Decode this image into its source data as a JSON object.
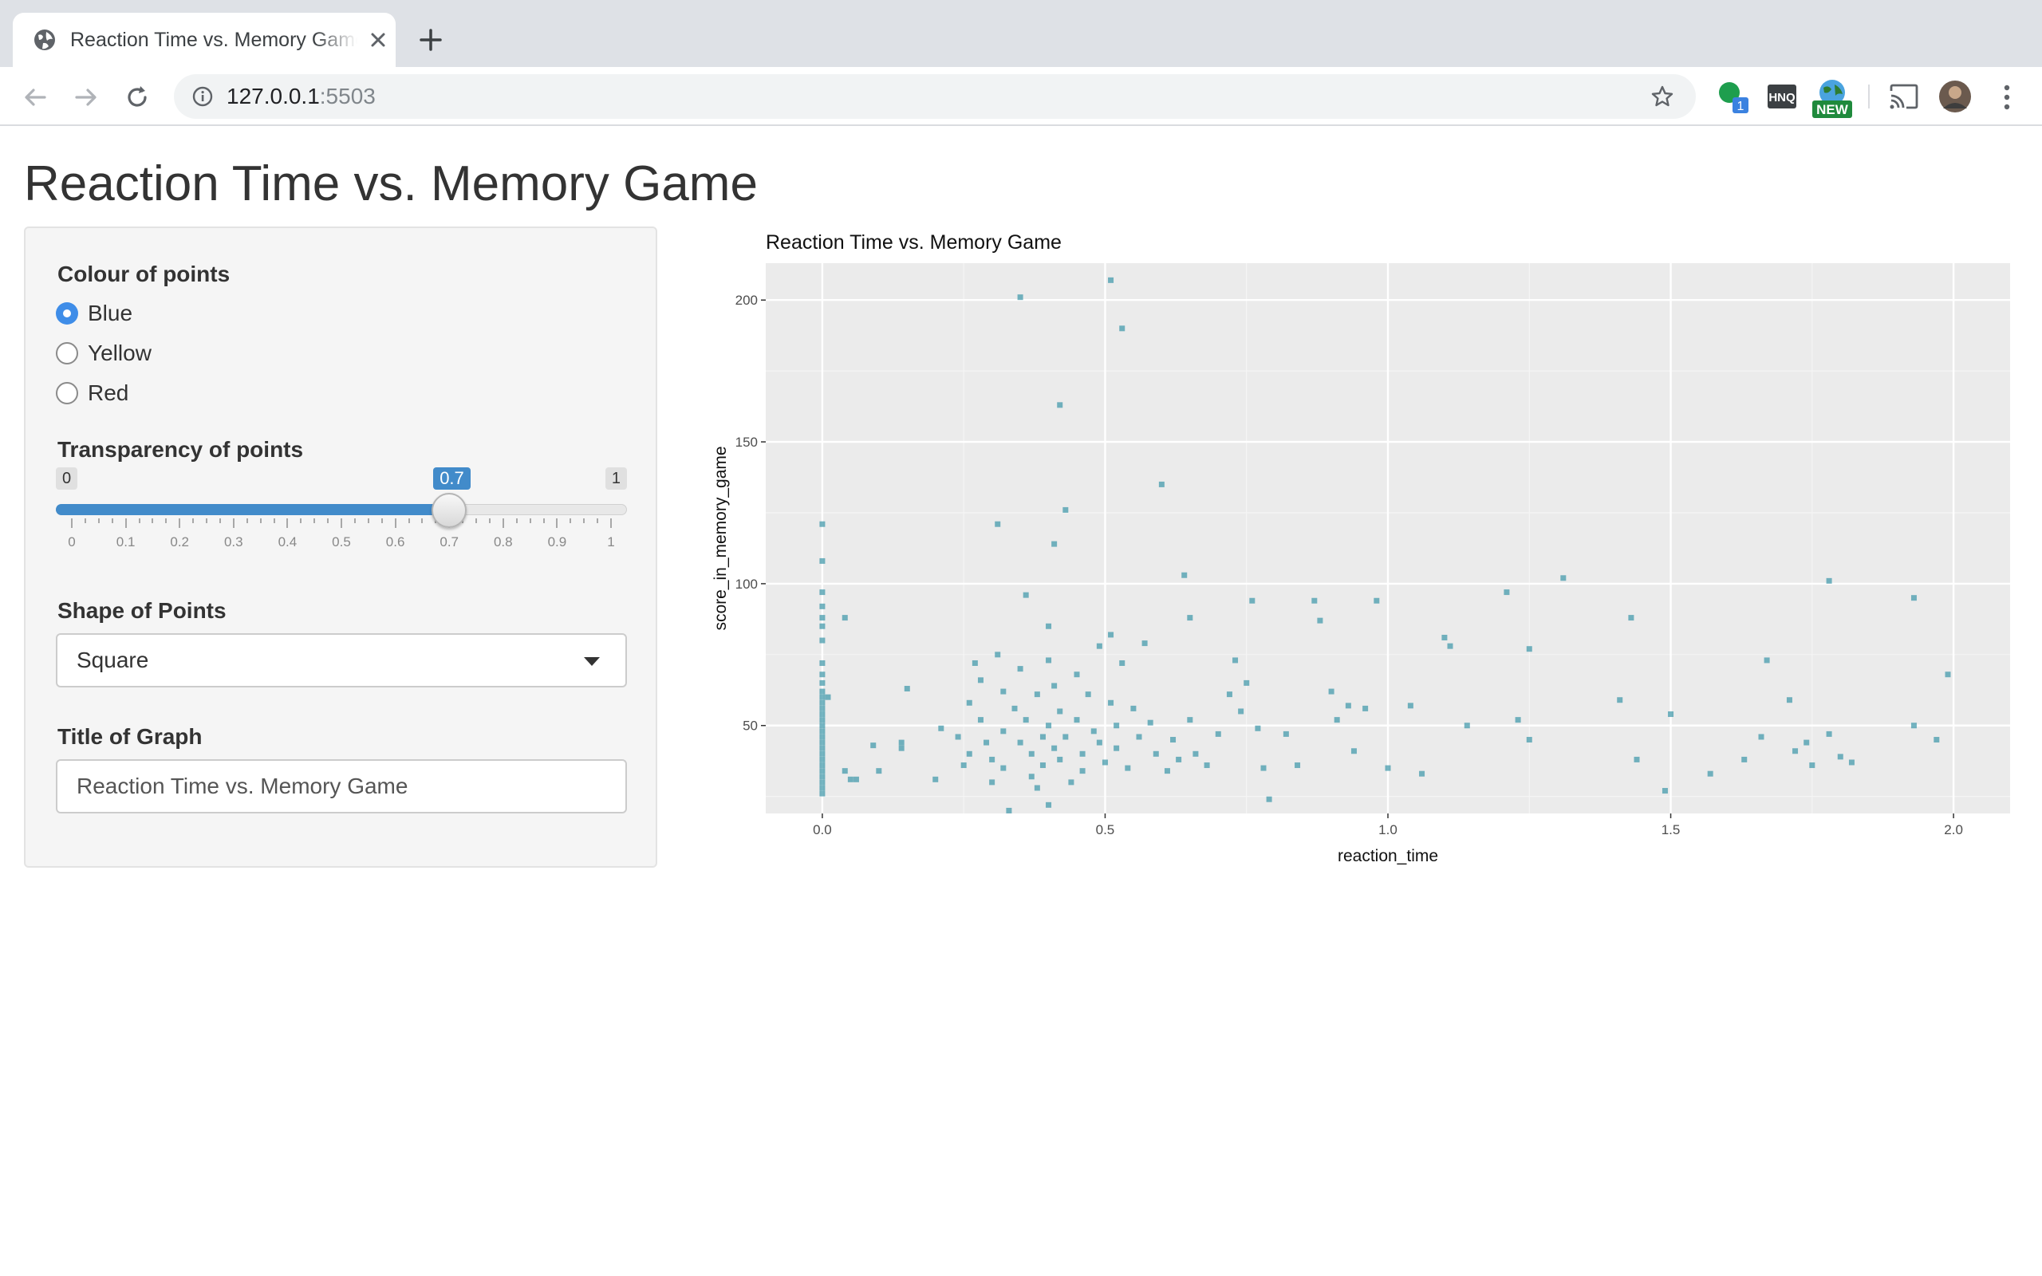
{
  "browser": {
    "tab_title": "Reaction Time vs. Memory Game",
    "url_host": "127.0.0.1",
    "url_port": ":5503",
    "extensions": [
      {
        "icon": "green-dot-extension-icon",
        "badge": "1"
      },
      {
        "icon": "hnq-extension-icon",
        "label": "HNQ"
      },
      {
        "icon": "globe-extension-icon",
        "badge": "NEW"
      },
      {
        "icon": "cast-icon"
      },
      {
        "icon": "profile-avatar"
      },
      {
        "icon": "more-menu-icon"
      }
    ]
  },
  "app": {
    "title": "Reaction Time vs. Memory Game"
  },
  "sidebar": {
    "colour": {
      "label": "Colour of points",
      "options": [
        "Blue",
        "Yellow",
        "Red"
      ],
      "selected": "Blue"
    },
    "transparency": {
      "label": "Transparency of points",
      "min": "0",
      "max": "1",
      "value": 0.7,
      "value_label": "0.7",
      "ticks": [
        "0",
        "0.1",
        "0.2",
        "0.3",
        "0.4",
        "0.5",
        "0.6",
        "0.7",
        "0.8",
        "0.9",
        "1"
      ]
    },
    "shape": {
      "label": "Shape of Points",
      "selected": "Square"
    },
    "graph_title": {
      "label": "Title of Graph",
      "value": "Reaction Time vs. Memory Game"
    }
  },
  "colors": {
    "point": "#3a95a8",
    "panel_bg": "#ebebeb",
    "accent": "#428bca"
  },
  "chart_data": {
    "type": "scatter",
    "title": "Reaction Time vs. Memory Game",
    "xlabel": "reaction_time",
    "ylabel": "score_in_memory_game",
    "xlim": [
      -0.1,
      2.1
    ],
    "ylim": [
      19,
      213
    ],
    "xticks": [
      "0.0",
      "0.5",
      "1.0",
      "1.5",
      "2.0"
    ],
    "yticks": [
      "50",
      "100",
      "150",
      "200"
    ],
    "grid": true,
    "marker": "square",
    "alpha": 0.7,
    "color": "#3a95a8",
    "points": [
      [
        0.0,
        121
      ],
      [
        0.0,
        108
      ],
      [
        0.0,
        97
      ],
      [
        0.0,
        92
      ],
      [
        0.0,
        88
      ],
      [
        0.0,
        85
      ],
      [
        0.0,
        80
      ],
      [
        0.0,
        72
      ],
      [
        0.0,
        68
      ],
      [
        0.0,
        65
      ],
      [
        0.0,
        62
      ],
      [
        0.0,
        60
      ],
      [
        0.0,
        58
      ],
      [
        0.0,
        56
      ],
      [
        0.0,
        54
      ],
      [
        0.0,
        52
      ],
      [
        0.0,
        50
      ],
      [
        0.0,
        48
      ],
      [
        0.0,
        46
      ],
      [
        0.0,
        44
      ],
      [
        0.0,
        42
      ],
      [
        0.0,
        40
      ],
      [
        0.0,
        38
      ],
      [
        0.0,
        36
      ],
      [
        0.0,
        34
      ],
      [
        0.0,
        32
      ],
      [
        0.0,
        30
      ],
      [
        0.0,
        28
      ],
      [
        0.0,
        26
      ],
      [
        0.01,
        60
      ],
      [
        0.04,
        88
      ],
      [
        0.04,
        34
      ],
      [
        0.05,
        31
      ],
      [
        0.06,
        31
      ],
      [
        0.09,
        43
      ],
      [
        0.1,
        34
      ],
      [
        0.14,
        44
      ],
      [
        0.14,
        42
      ],
      [
        0.15,
        63
      ],
      [
        0.2,
        31
      ],
      [
        0.21,
        49
      ],
      [
        0.24,
        46
      ],
      [
        0.25,
        36
      ],
      [
        0.26,
        40
      ],
      [
        0.26,
        58
      ],
      [
        0.27,
        72
      ],
      [
        0.28,
        66
      ],
      [
        0.28,
        52
      ],
      [
        0.29,
        44
      ],
      [
        0.3,
        38
      ],
      [
        0.3,
        30
      ],
      [
        0.31,
        121
      ],
      [
        0.31,
        75
      ],
      [
        0.32,
        62
      ],
      [
        0.32,
        48
      ],
      [
        0.32,
        35
      ],
      [
        0.33,
        20
      ],
      [
        0.34,
        56
      ],
      [
        0.35,
        201
      ],
      [
        0.35,
        70
      ],
      [
        0.35,
        44
      ],
      [
        0.36,
        96
      ],
      [
        0.36,
        52
      ],
      [
        0.37,
        40
      ],
      [
        0.37,
        32
      ],
      [
        0.38,
        61
      ],
      [
        0.38,
        28
      ],
      [
        0.39,
        46
      ],
      [
        0.39,
        36
      ],
      [
        0.4,
        85
      ],
      [
        0.4,
        73
      ],
      [
        0.4,
        50
      ],
      [
        0.4,
        22
      ],
      [
        0.41,
        114
      ],
      [
        0.41,
        64
      ],
      [
        0.41,
        42
      ],
      [
        0.42,
        163
      ],
      [
        0.42,
        55
      ],
      [
        0.42,
        38
      ],
      [
        0.43,
        126
      ],
      [
        0.43,
        46
      ],
      [
        0.44,
        30
      ],
      [
        0.45,
        68
      ],
      [
        0.45,
        52
      ],
      [
        0.46,
        40
      ],
      [
        0.46,
        34
      ],
      [
        0.47,
        61
      ],
      [
        0.48,
        48
      ],
      [
        0.49,
        78
      ],
      [
        0.49,
        44
      ],
      [
        0.5,
        37
      ],
      [
        0.51,
        207
      ],
      [
        0.51,
        82
      ],
      [
        0.51,
        58
      ],
      [
        0.52,
        50
      ],
      [
        0.52,
        42
      ],
      [
        0.53,
        190
      ],
      [
        0.53,
        72
      ],
      [
        0.54,
        35
      ],
      [
        0.55,
        56
      ],
      [
        0.56,
        46
      ],
      [
        0.57,
        79
      ],
      [
        0.58,
        51
      ],
      [
        0.59,
        40
      ],
      [
        0.6,
        135
      ],
      [
        0.61,
        34
      ],
      [
        0.62,
        45
      ],
      [
        0.63,
        38
      ],
      [
        0.64,
        103
      ],
      [
        0.65,
        52
      ],
      [
        0.65,
        88
      ],
      [
        0.66,
        40
      ],
      [
        0.68,
        36
      ],
      [
        0.7,
        47
      ],
      [
        0.72,
        61
      ],
      [
        0.73,
        73
      ],
      [
        0.74,
        55
      ],
      [
        0.75,
        65
      ],
      [
        0.76,
        94
      ],
      [
        0.77,
        49
      ],
      [
        0.78,
        35
      ],
      [
        0.79,
        24
      ],
      [
        0.82,
        47
      ],
      [
        0.84,
        36
      ],
      [
        0.87,
        94
      ],
      [
        0.88,
        87
      ],
      [
        0.9,
        62
      ],
      [
        0.91,
        52
      ],
      [
        0.93,
        57
      ],
      [
        0.94,
        41
      ],
      [
        0.96,
        56
      ],
      [
        0.98,
        94
      ],
      [
        1.0,
        35
      ],
      [
        1.04,
        57
      ],
      [
        1.06,
        33
      ],
      [
        1.1,
        81
      ],
      [
        1.11,
        78
      ],
      [
        1.14,
        50
      ],
      [
        1.21,
        97
      ],
      [
        1.23,
        52
      ],
      [
        1.25,
        77
      ],
      [
        1.25,
        45
      ],
      [
        1.31,
        102
      ],
      [
        1.41,
        59
      ],
      [
        1.43,
        88
      ],
      [
        1.44,
        38
      ],
      [
        1.49,
        27
      ],
      [
        1.5,
        54
      ],
      [
        1.57,
        33
      ],
      [
        1.63,
        38
      ],
      [
        1.66,
        46
      ],
      [
        1.67,
        73
      ],
      [
        1.71,
        59
      ],
      [
        1.72,
        41
      ],
      [
        1.74,
        44
      ],
      [
        1.75,
        36
      ],
      [
        1.78,
        101
      ],
      [
        1.78,
        47
      ],
      [
        1.8,
        39
      ],
      [
        1.82,
        37
      ],
      [
        1.93,
        95
      ],
      [
        1.93,
        50
      ],
      [
        1.97,
        45
      ],
      [
        1.99,
        68
      ]
    ]
  }
}
